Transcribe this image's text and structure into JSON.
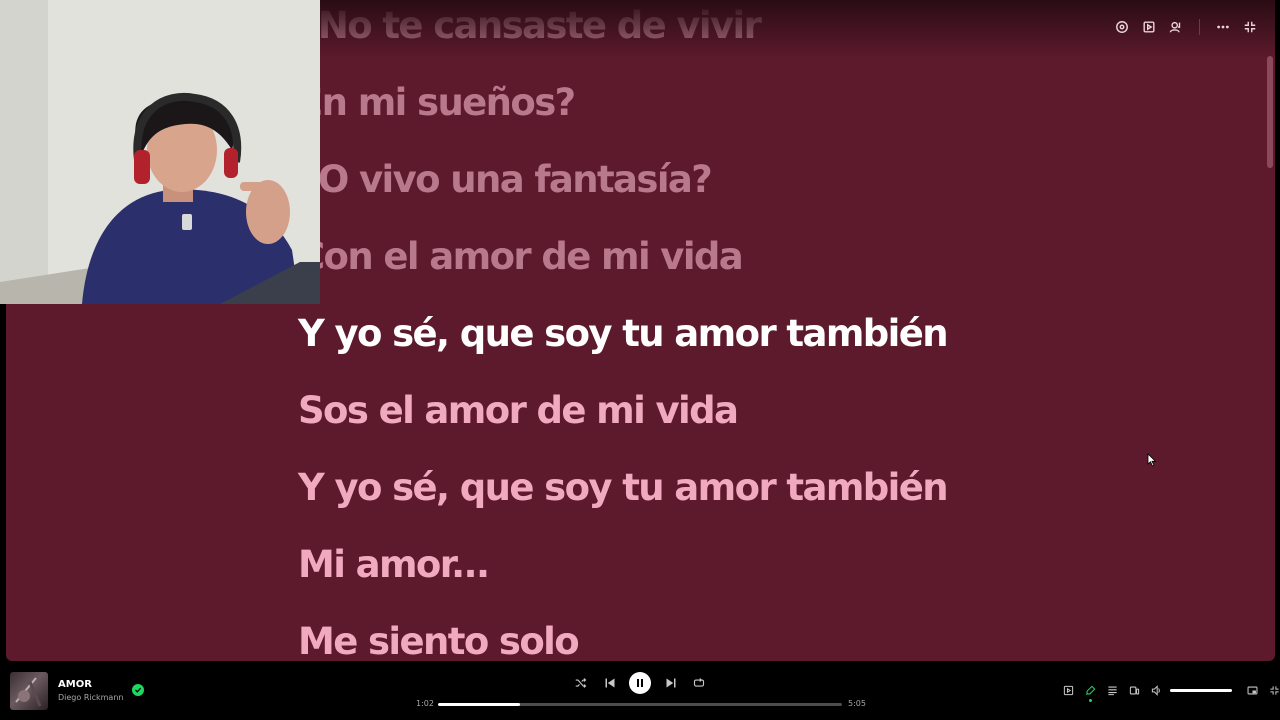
{
  "lyrics": {
    "lines": [
      {
        "text": "¿No te cansaste de vivir",
        "state": "past"
      },
      {
        "text": "En mi sueños?",
        "state": "past"
      },
      {
        "text": "¿O vivo una fantasía?",
        "state": "past"
      },
      {
        "text": "Con el amor de mi vida",
        "state": "past"
      },
      {
        "text": "Y yo sé, que soy tu amor también",
        "state": "active"
      },
      {
        "text": "Sos el amor de mi vida",
        "state": "upcoming"
      },
      {
        "text": "Y yo sé, que soy tu amor también",
        "state": "upcoming"
      },
      {
        "text": "Mi amor...",
        "state": "upcoming"
      },
      {
        "text": "Me siento solo",
        "state": "upcoming"
      }
    ]
  },
  "now_playing": {
    "title": "AMOR",
    "artist": "Diego Rickmann",
    "liked": true
  },
  "playback": {
    "elapsed": "1:02",
    "duration": "5:05",
    "progress": 0.204,
    "is_playing": true
  },
  "volume": {
    "level": 1.0
  },
  "colors": {
    "lyrics_background": "#5e1a2d",
    "active_lyric": "#ffffff",
    "upcoming_lyric": "#f0a9bf",
    "accent_green": "#1ed760"
  },
  "icons": {
    "top_actions": [
      "radio-icon",
      "now-playing-view-icon",
      "connect-device-icon",
      "more-icon",
      "exit-fullscreen-icon"
    ],
    "player": [
      "shuffle-icon",
      "previous-icon",
      "pause-icon",
      "next-icon",
      "repeat-icon"
    ],
    "right": [
      "now-playing-view-icon",
      "lyrics-mic-icon",
      "queue-icon",
      "connect-device-icon",
      "volume-icon",
      "miniplayer-icon",
      "fullscreen-icon"
    ]
  }
}
